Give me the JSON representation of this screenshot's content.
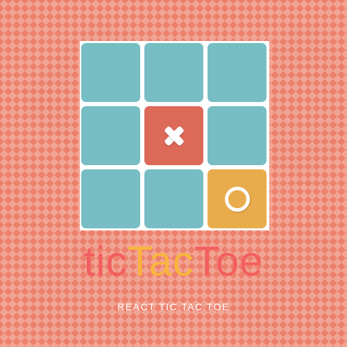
{
  "board": {
    "cells": [
      "",
      "",
      "",
      "",
      "X",
      "",
      "",
      "",
      "O"
    ],
    "colors": {
      "empty": "#77bec4",
      "x": "#dd6959",
      "o": "#e9ac4c"
    }
  },
  "title": {
    "part1": "tic",
    "part2": "Tac",
    "part3": "Toe",
    "colors": [
      "#f35e5f",
      "#f9b43e",
      "#f35e5f"
    ]
  },
  "subtitle": "REACT TIC TAC TOE"
}
